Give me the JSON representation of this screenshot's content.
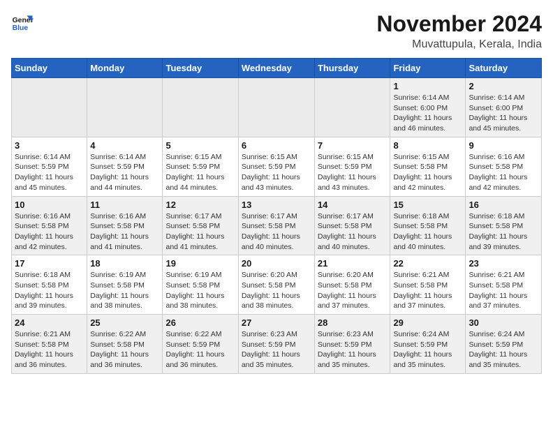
{
  "logo": {
    "line1": "General",
    "line2": "Blue"
  },
  "title": "November 2024",
  "location": "Muvattupula, Kerala, India",
  "weekdays": [
    "Sunday",
    "Monday",
    "Tuesday",
    "Wednesday",
    "Thursday",
    "Friday",
    "Saturday"
  ],
  "weeks": [
    [
      {
        "day": "",
        "info": ""
      },
      {
        "day": "",
        "info": ""
      },
      {
        "day": "",
        "info": ""
      },
      {
        "day": "",
        "info": ""
      },
      {
        "day": "",
        "info": ""
      },
      {
        "day": "1",
        "info": "Sunrise: 6:14 AM\nSunset: 6:00 PM\nDaylight: 11 hours and 46 minutes."
      },
      {
        "day": "2",
        "info": "Sunrise: 6:14 AM\nSunset: 6:00 PM\nDaylight: 11 hours and 45 minutes."
      }
    ],
    [
      {
        "day": "3",
        "info": "Sunrise: 6:14 AM\nSunset: 5:59 PM\nDaylight: 11 hours and 45 minutes."
      },
      {
        "day": "4",
        "info": "Sunrise: 6:14 AM\nSunset: 5:59 PM\nDaylight: 11 hours and 44 minutes."
      },
      {
        "day": "5",
        "info": "Sunrise: 6:15 AM\nSunset: 5:59 PM\nDaylight: 11 hours and 44 minutes."
      },
      {
        "day": "6",
        "info": "Sunrise: 6:15 AM\nSunset: 5:59 PM\nDaylight: 11 hours and 43 minutes."
      },
      {
        "day": "7",
        "info": "Sunrise: 6:15 AM\nSunset: 5:59 PM\nDaylight: 11 hours and 43 minutes."
      },
      {
        "day": "8",
        "info": "Sunrise: 6:15 AM\nSunset: 5:58 PM\nDaylight: 11 hours and 42 minutes."
      },
      {
        "day": "9",
        "info": "Sunrise: 6:16 AM\nSunset: 5:58 PM\nDaylight: 11 hours and 42 minutes."
      }
    ],
    [
      {
        "day": "10",
        "info": "Sunrise: 6:16 AM\nSunset: 5:58 PM\nDaylight: 11 hours and 42 minutes."
      },
      {
        "day": "11",
        "info": "Sunrise: 6:16 AM\nSunset: 5:58 PM\nDaylight: 11 hours and 41 minutes."
      },
      {
        "day": "12",
        "info": "Sunrise: 6:17 AM\nSunset: 5:58 PM\nDaylight: 11 hours and 41 minutes."
      },
      {
        "day": "13",
        "info": "Sunrise: 6:17 AM\nSunset: 5:58 PM\nDaylight: 11 hours and 40 minutes."
      },
      {
        "day": "14",
        "info": "Sunrise: 6:17 AM\nSunset: 5:58 PM\nDaylight: 11 hours and 40 minutes."
      },
      {
        "day": "15",
        "info": "Sunrise: 6:18 AM\nSunset: 5:58 PM\nDaylight: 11 hours and 40 minutes."
      },
      {
        "day": "16",
        "info": "Sunrise: 6:18 AM\nSunset: 5:58 PM\nDaylight: 11 hours and 39 minutes."
      }
    ],
    [
      {
        "day": "17",
        "info": "Sunrise: 6:18 AM\nSunset: 5:58 PM\nDaylight: 11 hours and 39 minutes."
      },
      {
        "day": "18",
        "info": "Sunrise: 6:19 AM\nSunset: 5:58 PM\nDaylight: 11 hours and 38 minutes."
      },
      {
        "day": "19",
        "info": "Sunrise: 6:19 AM\nSunset: 5:58 PM\nDaylight: 11 hours and 38 minutes."
      },
      {
        "day": "20",
        "info": "Sunrise: 6:20 AM\nSunset: 5:58 PM\nDaylight: 11 hours and 38 minutes."
      },
      {
        "day": "21",
        "info": "Sunrise: 6:20 AM\nSunset: 5:58 PM\nDaylight: 11 hours and 37 minutes."
      },
      {
        "day": "22",
        "info": "Sunrise: 6:21 AM\nSunset: 5:58 PM\nDaylight: 11 hours and 37 minutes."
      },
      {
        "day": "23",
        "info": "Sunrise: 6:21 AM\nSunset: 5:58 PM\nDaylight: 11 hours and 37 minutes."
      }
    ],
    [
      {
        "day": "24",
        "info": "Sunrise: 6:21 AM\nSunset: 5:58 PM\nDaylight: 11 hours and 36 minutes."
      },
      {
        "day": "25",
        "info": "Sunrise: 6:22 AM\nSunset: 5:58 PM\nDaylight: 11 hours and 36 minutes."
      },
      {
        "day": "26",
        "info": "Sunrise: 6:22 AM\nSunset: 5:59 PM\nDaylight: 11 hours and 36 minutes."
      },
      {
        "day": "27",
        "info": "Sunrise: 6:23 AM\nSunset: 5:59 PM\nDaylight: 11 hours and 35 minutes."
      },
      {
        "day": "28",
        "info": "Sunrise: 6:23 AM\nSunset: 5:59 PM\nDaylight: 11 hours and 35 minutes."
      },
      {
        "day": "29",
        "info": "Sunrise: 6:24 AM\nSunset: 5:59 PM\nDaylight: 11 hours and 35 minutes."
      },
      {
        "day": "30",
        "info": "Sunrise: 6:24 AM\nSunset: 5:59 PM\nDaylight: 11 hours and 35 minutes."
      }
    ]
  ]
}
